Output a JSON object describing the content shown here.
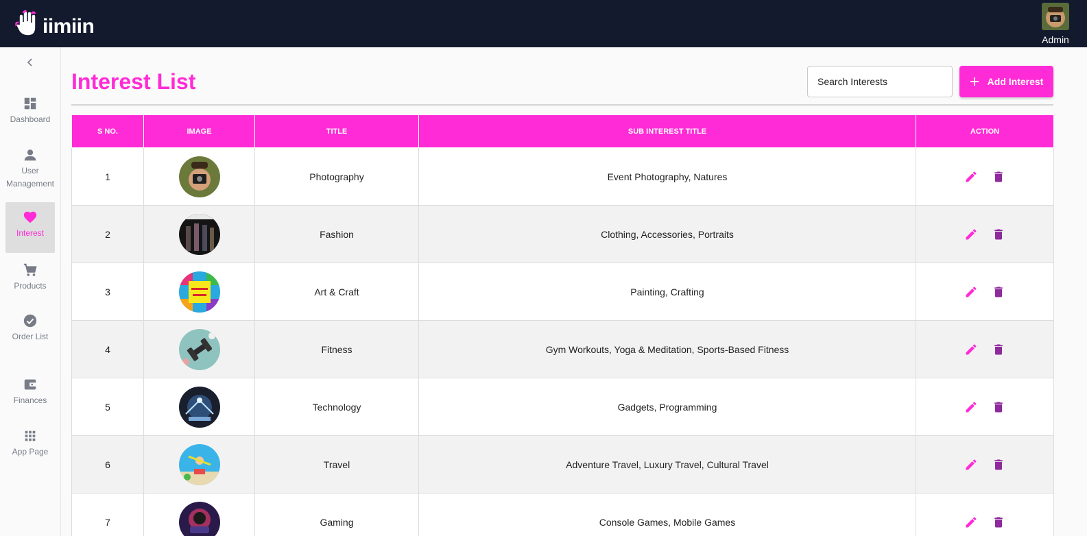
{
  "app": {
    "brand": "iimiin"
  },
  "header": {
    "user_label": "Admin"
  },
  "sidebar": {
    "items": [
      {
        "key": "dashboard",
        "label": "Dashboard",
        "icon": "dashboard-icon"
      },
      {
        "key": "user-management",
        "label": "User Management",
        "icon": "person-icon"
      },
      {
        "key": "interest",
        "label": "Interest",
        "icon": "heart-icon",
        "active": true
      },
      {
        "key": "products",
        "label": "Products",
        "icon": "cart-icon"
      },
      {
        "key": "order-list",
        "label": "Order List",
        "icon": "check-circle-icon"
      },
      {
        "key": "finances",
        "label": "Finances",
        "icon": "wallet-icon"
      },
      {
        "key": "app-page",
        "label": "App Page",
        "icon": "apps-grid-icon"
      }
    ]
  },
  "page": {
    "title": "Interest List",
    "search_placeholder": "Search Interests",
    "add_button_label": "Add Interest"
  },
  "table": {
    "columns": [
      "S NO.",
      "IMAGE",
      "TITLE",
      "SUB INTEREST TITLE",
      "ACTION"
    ],
    "rows": [
      {
        "sno": "1",
        "title": "Photography",
        "sub": "Event Photography, Natures"
      },
      {
        "sno": "2",
        "title": "Fashion",
        "sub": "Clothing, Accessories, Portraits"
      },
      {
        "sno": "3",
        "title": "Art & Craft",
        "sub": "Painting, Crafting"
      },
      {
        "sno": "4",
        "title": "Fitness",
        "sub": "Gym Workouts, Yoga & Meditation, Sports-Based Fitness"
      },
      {
        "sno": "5",
        "title": "Technology",
        "sub": "Gadgets, Programming"
      },
      {
        "sno": "6",
        "title": "Travel",
        "sub": "Adventure Travel, Luxury Travel, Cultural Travel"
      },
      {
        "sno": "7",
        "title": "Gaming",
        "sub": "Console Games, Mobile Games"
      }
    ]
  },
  "colors": {
    "accent": "#ff2bd6",
    "header_bg": "#141a2e",
    "delete_icon": "#8e2a9c",
    "sidebar_text": "#777c87"
  }
}
